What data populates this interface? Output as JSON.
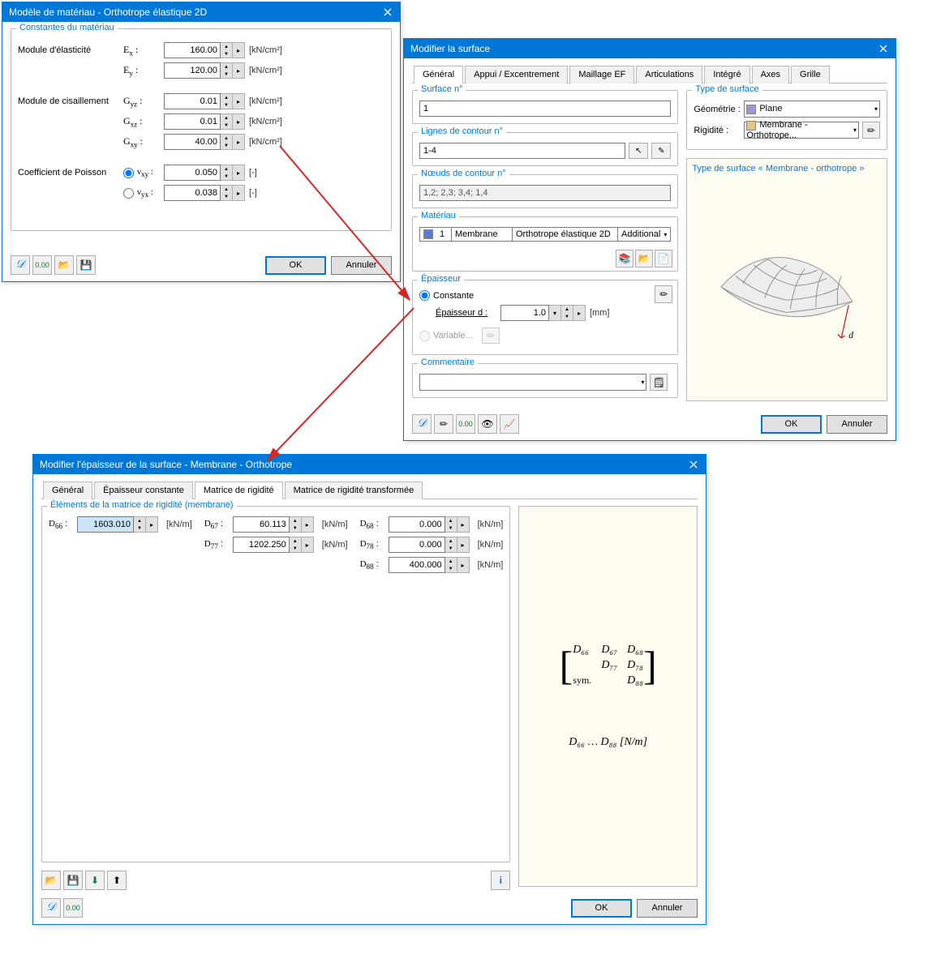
{
  "dialog1": {
    "title": "Modèle de matériau - Orthotrope élastique 2D",
    "group_title": "Constantes du matériau",
    "elasticity_label": "Module d'élasticité",
    "ex_label": "E",
    "ex_sub": "x",
    "ex_val": "160.00",
    "ey_label": "E",
    "ey_sub": "y",
    "ey_val": "120.00",
    "shear_label": "Module de cisaillement",
    "gyz_label": "G",
    "gyz_sub": "yz",
    "gyz_val": "0.01",
    "gxz_label": "G",
    "gxz_sub": "xz",
    "gxz_val": "0.01",
    "gxy_label": "G",
    "gxy_sub": "xy",
    "gxy_val": "40.00",
    "poisson_label": "Coefficient de Poisson",
    "vxy_label": "ν",
    "vxy_sub": "xy",
    "vxy_val": "0.050",
    "vyx_label": "ν",
    "vyx_sub": "yx",
    "vyx_val": "0.038",
    "unit_kncm2": "[kN/cm²]",
    "unit_dash": "[-]",
    "ok": "OK",
    "cancel": "Annuler"
  },
  "dialog2": {
    "title": "Modifier la surface",
    "tabs": [
      "Général",
      "Appui / Excentrement",
      "Maillage EF",
      "Articulations",
      "Intégré",
      "Axes",
      "Grille"
    ],
    "grp_surface": "Surface n°",
    "surface_val": "1",
    "grp_contour": "Lignes de contour n°",
    "contour_val": "1-4",
    "grp_nodes": "Nœuds de contour n°",
    "nodes_val": "1,2; 2,3; 3,4; 1,4",
    "grp_material": "Matériau",
    "mat_num": "1",
    "mat_name": "Membrane",
    "mat_model": "Orthotrope élastique 2D",
    "mat_cat": "Additional",
    "grp_thickness": "Épaisseur",
    "thick_const": "Constante",
    "thick_d_label": "Épaisseur d :",
    "thick_d_val": "1.0",
    "thick_unit": "[mm]",
    "thick_var": "Variable...",
    "grp_comment": "Commentaire",
    "grp_type": "Type de surface",
    "geom_label": "Géométrie :",
    "geom_val": "Plane",
    "rigid_label": "Rigidité :",
    "rigid_val": "Membrane - Orthotrope...",
    "preview_title": "Type de surface « Membrane - orthotrope »",
    "ok": "OK",
    "cancel": "Annuler"
  },
  "dialog3": {
    "title": "Modifier l'épaisseur de la surface - Membrane - Orthotrope",
    "tabs": [
      "Général",
      "Épaisseur constante",
      "Matrice de rigidité",
      "Matrice de rigidité transformée"
    ],
    "grp_elements": "Éléments de la matrice de rigidité (membrane)",
    "D66_lbl": "D66 :",
    "D66_val": "1603.010",
    "D67_lbl": "D67 :",
    "D67_val": "60.113",
    "D68_lbl": "D68 :",
    "D68_val": "0.000",
    "D77_lbl": "D77 :",
    "D77_val": "1202.250",
    "D78_lbl": "D78 :",
    "D78_val": "0.000",
    "D88_lbl": "D88 :",
    "D88_val": "400.000",
    "unit_knm": "[kN/m]",
    "matrix_labels": {
      "D66": "D₆₆",
      "D67": "D₆₇",
      "D68": "D₆₈",
      "D77": "D₇₇",
      "D78": "D₇₈",
      "D88": "D₈₈",
      "sym": "sym."
    },
    "range_note": "D₆₆ … D₈₈   [N/m]",
    "ok": "OK",
    "cancel": "Annuler"
  }
}
